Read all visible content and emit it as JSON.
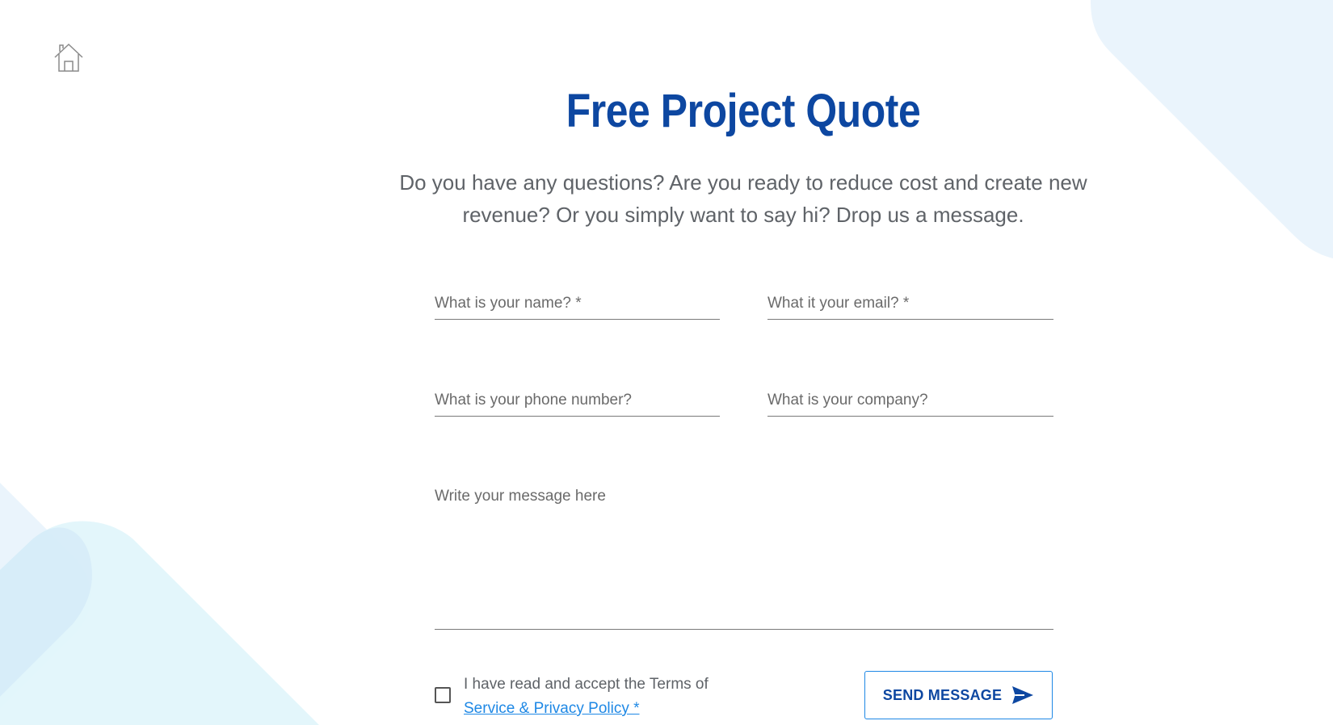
{
  "page": {
    "title": "Free Project Quote",
    "subtitle": "Do you have any questions? Are you ready to reduce cost and create new revenue? Or you simply want to say hi? Drop us a message."
  },
  "nav": {
    "home_icon": "home-icon"
  },
  "form": {
    "name_placeholder": "What is your name? *",
    "email_placeholder": "What it your email? *",
    "phone_placeholder": "What is your phone number?",
    "company_placeholder": "What is your company?",
    "message_placeholder": "Write your message here",
    "name_value": "",
    "email_value": "",
    "phone_value": "",
    "company_value": "",
    "message_value": "",
    "consent_text": "I have read and accept the Terms of",
    "consent_link": "Service & Privacy Policy *",
    "consent_checked": false,
    "send_label": "SEND MESSAGE",
    "send_icon": "send-icon"
  },
  "colors": {
    "accent": "#0d47a1",
    "link": "#1e88e5",
    "text": "#5f6368",
    "bg_shape_light": "#eaf4fc",
    "bg_shape_cyan": "#e1f5fb"
  }
}
